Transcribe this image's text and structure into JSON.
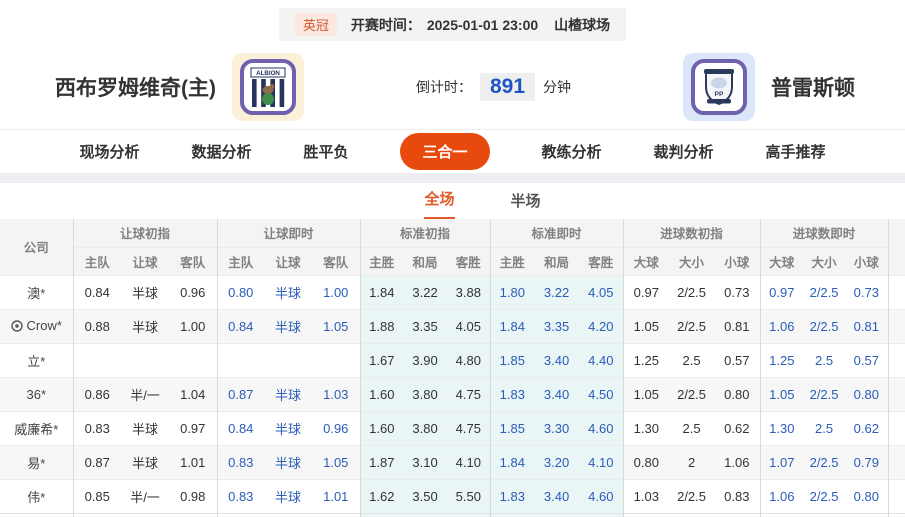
{
  "top_bar": {
    "league": "英冠",
    "kickoff_label": "开赛时间：",
    "kickoff_time": "2025-01-01 23:00",
    "venue": "山楂球场"
  },
  "match": {
    "home_name": "西布罗姆维奇(主)",
    "home_badge_text": "ALBION",
    "away_name": "普雷斯顿",
    "away_badge_text": "PP",
    "countdown_label": "倒计时：",
    "countdown_value": "891",
    "countdown_unit": "分钟"
  },
  "nav": {
    "items": [
      {
        "label": "现场分析",
        "active": false
      },
      {
        "label": "数据分析",
        "active": false
      },
      {
        "label": "胜平负",
        "active": false
      },
      {
        "label": "三合一",
        "active": true
      },
      {
        "label": "教练分析",
        "active": false
      },
      {
        "label": "裁判分析",
        "active": false
      },
      {
        "label": "高手推荐",
        "active": false
      }
    ]
  },
  "subtabs": {
    "items": [
      {
        "label": "全场",
        "active": true
      },
      {
        "label": "半场",
        "active": false
      }
    ]
  },
  "table": {
    "company_header": "公司",
    "groups": [
      {
        "label": "让球初指",
        "cols": [
          "主队",
          "让球",
          "客队"
        ]
      },
      {
        "label": "让球即时",
        "cols": [
          "主队",
          "让球",
          "客队"
        ]
      },
      {
        "label": "标准初指",
        "cols": [
          "主胜",
          "和局",
          "客胜"
        ]
      },
      {
        "label": "标准即时",
        "cols": [
          "主胜",
          "和局",
          "客胜"
        ]
      },
      {
        "label": "进球数初指",
        "cols": [
          "大球",
          "大小",
          "小球"
        ]
      },
      {
        "label": "进球数即时",
        "cols": [
          "大球",
          "大小",
          "小球"
        ]
      }
    ],
    "rows": [
      {
        "company": "澳*",
        "has_icon": false,
        "handicap_initial": [
          "0.84",
          "半球",
          "0.96"
        ],
        "handicap_live": [
          "0.80",
          "半球",
          "1.00"
        ],
        "std_initial": [
          "1.84",
          "3.22",
          "3.88"
        ],
        "std_live": [
          "1.80",
          "3.22",
          "4.05"
        ],
        "goals_initial": [
          "0.97",
          "2/2.5",
          "0.73"
        ],
        "goals_live": [
          "0.97",
          "2/2.5",
          "0.73"
        ]
      },
      {
        "company": "Crow*",
        "has_icon": true,
        "handicap_initial": [
          "0.88",
          "半球",
          "1.00"
        ],
        "handicap_live": [
          "0.84",
          "半球",
          "1.05"
        ],
        "std_initial": [
          "1.88",
          "3.35",
          "4.05"
        ],
        "std_live": [
          "1.84",
          "3.35",
          "4.20"
        ],
        "goals_initial": [
          "1.05",
          "2/2.5",
          "0.81"
        ],
        "goals_live": [
          "1.06",
          "2/2.5",
          "0.81"
        ]
      },
      {
        "company": "立*",
        "has_icon": false,
        "handicap_initial": [
          "",
          "",
          ""
        ],
        "handicap_live": [
          "",
          "",
          ""
        ],
        "std_initial": [
          "1.67",
          "3.90",
          "4.80"
        ],
        "std_live": [
          "1.85",
          "3.40",
          "4.40"
        ],
        "goals_initial": [
          "1.25",
          "2.5",
          "0.57"
        ],
        "goals_live": [
          "1.25",
          "2.5",
          "0.57"
        ]
      },
      {
        "company": "36*",
        "has_icon": false,
        "handicap_initial": [
          "0.86",
          "半/一",
          "1.04"
        ],
        "handicap_live": [
          "0.87",
          "半球",
          "1.03"
        ],
        "std_initial": [
          "1.60",
          "3.80",
          "4.75"
        ],
        "std_live": [
          "1.83",
          "3.40",
          "4.50"
        ],
        "goals_initial": [
          "1.05",
          "2/2.5",
          "0.80"
        ],
        "goals_live": [
          "1.05",
          "2/2.5",
          "0.80"
        ]
      },
      {
        "company": "威廉希*",
        "has_icon": false,
        "handicap_initial": [
          "0.83",
          "半球",
          "0.97"
        ],
        "handicap_live": [
          "0.84",
          "半球",
          "0.96"
        ],
        "std_initial": [
          "1.60",
          "3.80",
          "4.75"
        ],
        "std_live": [
          "1.85",
          "3.30",
          "4.60"
        ],
        "goals_initial": [
          "1.30",
          "2.5",
          "0.62"
        ],
        "goals_live": [
          "1.30",
          "2.5",
          "0.62"
        ]
      },
      {
        "company": "易*",
        "has_icon": false,
        "handicap_initial": [
          "0.87",
          "半球",
          "1.01"
        ],
        "handicap_live": [
          "0.83",
          "半球",
          "1.05"
        ],
        "std_initial": [
          "1.87",
          "3.10",
          "4.10"
        ],
        "std_live": [
          "1.84",
          "3.20",
          "4.10"
        ],
        "goals_initial": [
          "0.80",
          "2",
          "1.06"
        ],
        "goals_live": [
          "1.07",
          "2/2.5",
          "0.79"
        ]
      },
      {
        "company": "伟*",
        "has_icon": false,
        "handicap_initial": [
          "0.85",
          "半/一",
          "0.98"
        ],
        "handicap_live": [
          "0.83",
          "半球",
          "1.01"
        ],
        "std_initial": [
          "1.62",
          "3.50",
          "5.50"
        ],
        "std_live": [
          "1.83",
          "3.40",
          "4.60"
        ],
        "goals_initial": [
          "1.03",
          "2/2.5",
          "0.83"
        ],
        "goals_live": [
          "1.06",
          "2/2.5",
          "0.80"
        ]
      }
    ]
  },
  "colors": {
    "accent_orange": "#e84a0e",
    "tab_orange": "#e05a28",
    "live_blue": "#2b5cb8",
    "countdown_blue": "#1d56c4",
    "std_column_cyan": "#e9f6f5"
  }
}
